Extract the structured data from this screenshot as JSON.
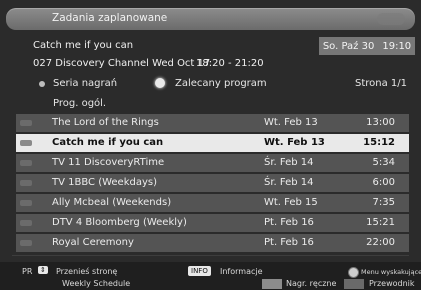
{
  "window": {
    "title": "Zadania zaplanowane"
  },
  "header": {
    "program_title": "Catch me if you can",
    "channel_line": "027 Discovery Channel Wed Oct 17",
    "time_range": "18:20 - 21:20",
    "current_date": "So. Paź 30",
    "current_time": "19:10"
  },
  "filters": {
    "series_label": "Seria nagrań",
    "recommended_label": "Zalecany program",
    "page_label": "Strona 1/1"
  },
  "category": {
    "label": "Prog. ogól."
  },
  "rows": [
    {
      "name": "The Lord of the Rings",
      "date": "Wt. Feb 13",
      "time": "13:00"
    },
    {
      "name": "Catch me if you can",
      "date": "Wt. Feb 13",
      "time": "15:12"
    },
    {
      "name": "TV  11 DiscoveryRTime",
      "date": "Śr. Feb 14",
      "time": "5:34"
    },
    {
      "name": "TV  1BBC (Weekdays)",
      "date": "Śr. Feb 14",
      "time": "6:00"
    },
    {
      "name": "Ally Mcbeal (Weekends)",
      "date": "Wt. Feb 15",
      "time": "7:35"
    },
    {
      "name": "DTV 4 Bloomberg (Weekly)",
      "date": "Pt. Feb 16",
      "time": "15:21"
    },
    {
      "name": "Royal Ceremony",
      "date": "Pt. Feb 16",
      "time": "22:00"
    }
  ],
  "footer": {
    "pr_key": "PR",
    "move_page": "Przenieś stronę",
    "info_key": "INFO",
    "info_label": "Informacje",
    "popup_menu": "Menu wyskakujące",
    "weekly": "Weekly Schedule",
    "manual_rec": "Nagr. ręczne",
    "guide": "Przewodnik"
  }
}
